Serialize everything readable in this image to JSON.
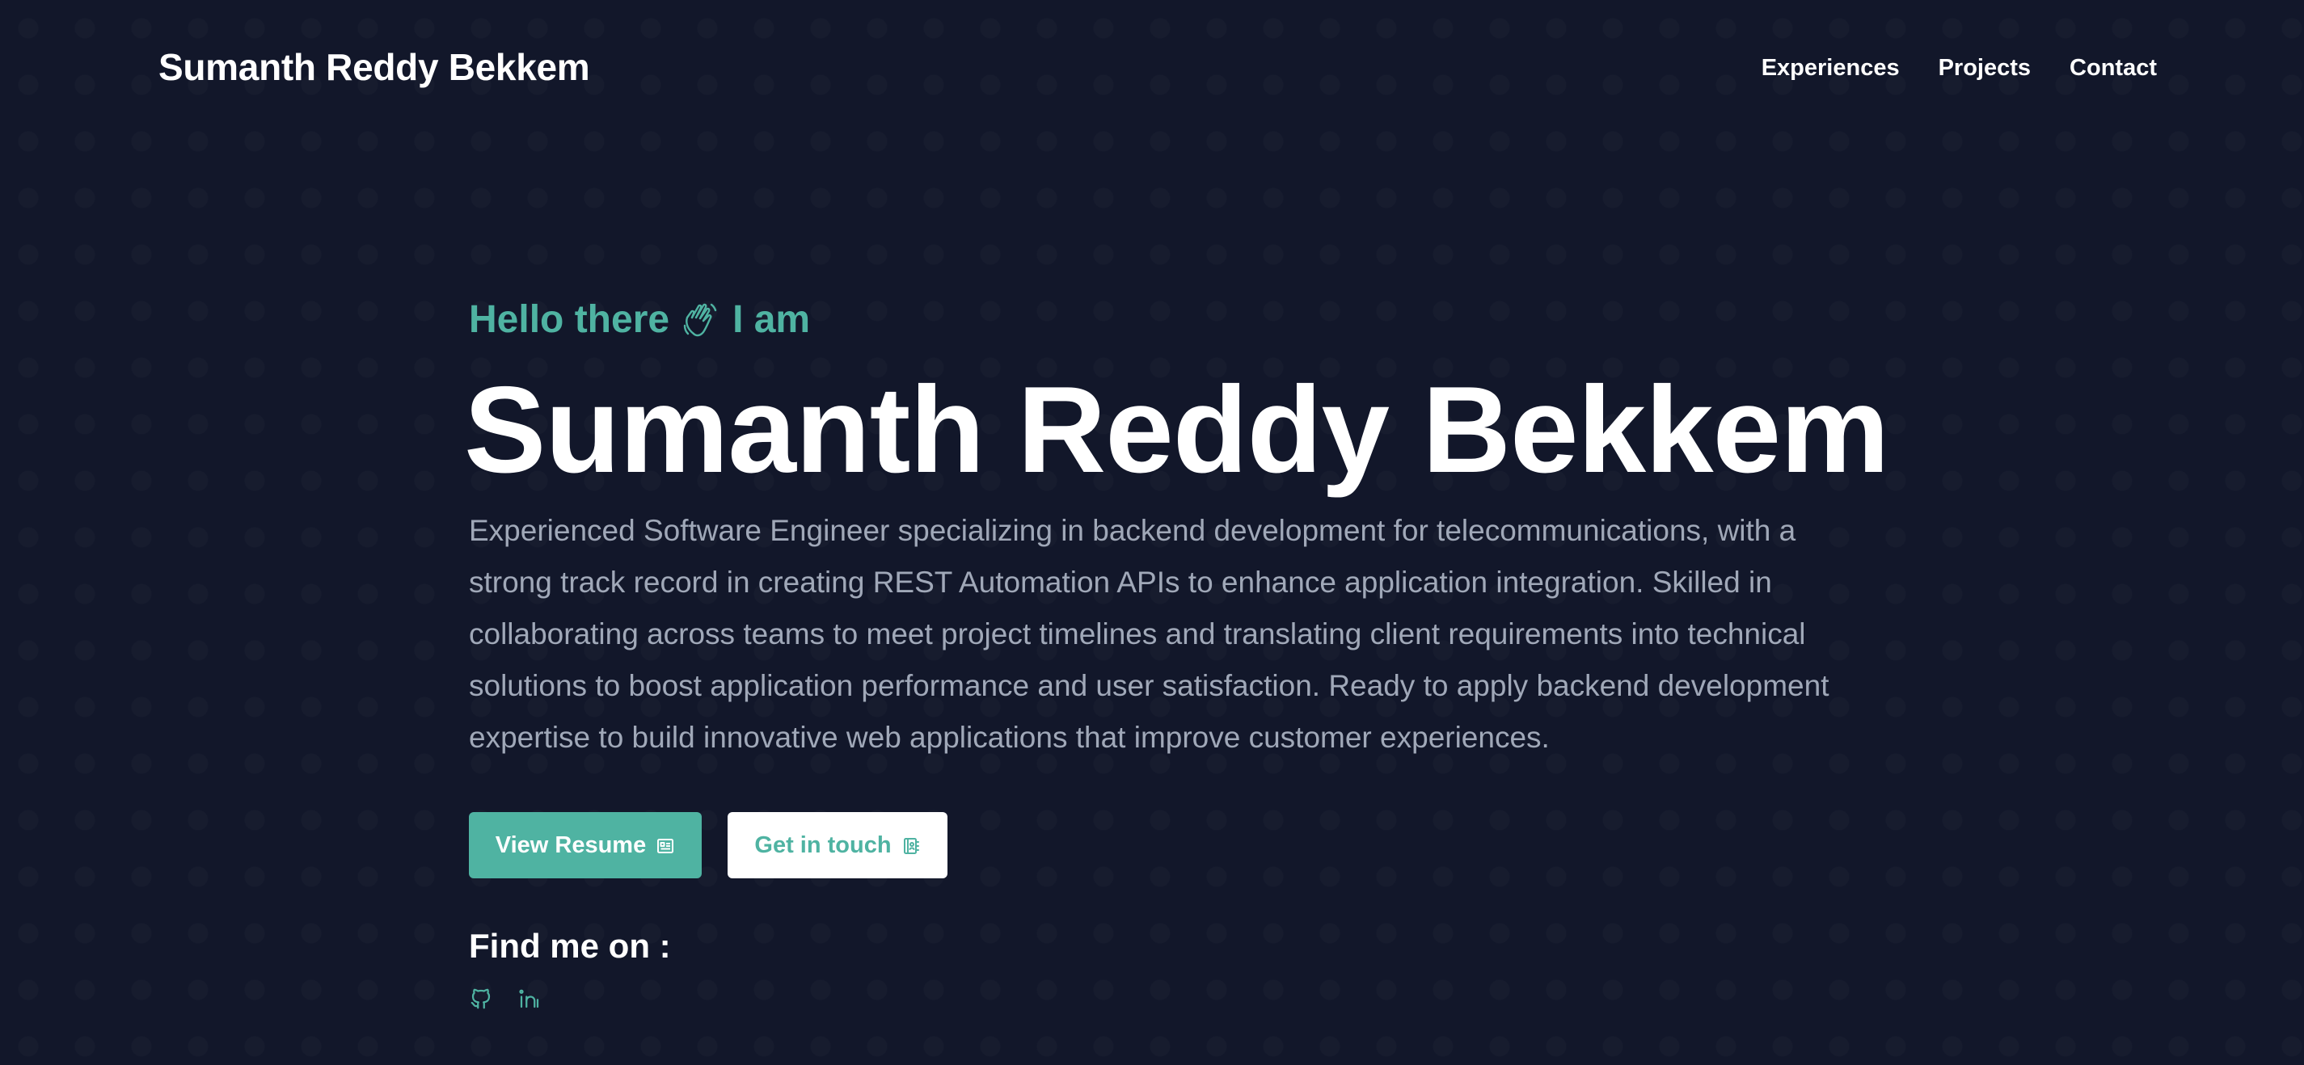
{
  "header": {
    "brand": "Sumanth Reddy Bekkem",
    "nav": [
      {
        "label": "Experiences"
      },
      {
        "label": "Projects"
      },
      {
        "label": "Contact"
      }
    ]
  },
  "hero": {
    "greeting_prefix": "Hello there",
    "greeting_icon": "waving-hand-icon",
    "greeting_suffix": "I am",
    "name": "Sumanth Reddy Bekkem",
    "bio": "Experienced Software Engineer specializing in backend development for telecommunications, with a strong track record in creating REST Automation APIs to enhance application integration. Skilled in collaborating across teams to meet project timelines and translating client requirements into technical solutions to boost application performance and user satisfaction. Ready to apply backend development expertise to build innovative web applications that improve customer experiences.",
    "primary_button": {
      "label": "View Resume",
      "icon": "resume-icon"
    },
    "secondary_button": {
      "label": "Get in touch",
      "icon": "contact-book-icon"
    },
    "find_me_title": "Find me on :",
    "socials": [
      {
        "icon": "github-icon"
      },
      {
        "icon": "linkedin-icon"
      }
    ]
  },
  "colors": {
    "background": "#12172a",
    "accent": "#4fb3a2",
    "text_primary": "#ffffff",
    "text_muted": "#a0a8b8"
  }
}
